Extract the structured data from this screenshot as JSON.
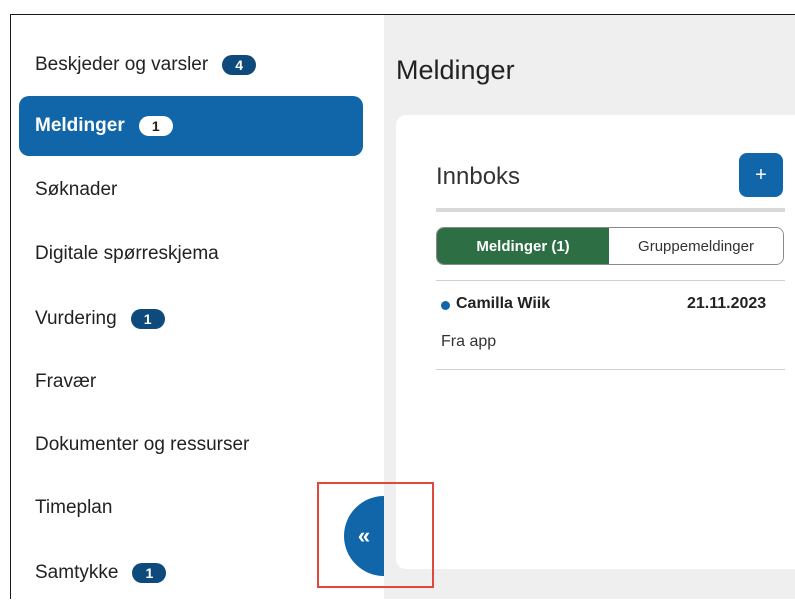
{
  "sidebar": {
    "items": [
      {
        "label": "Beskjeder og varsler",
        "badge": "4"
      },
      {
        "label": "Meldinger",
        "badge": "1"
      },
      {
        "label": "Søknader",
        "badge": ""
      },
      {
        "label": "Digitale spørreskjema",
        "badge": ""
      },
      {
        "label": "Vurdering",
        "badge": "1"
      },
      {
        "label": "Fravær",
        "badge": ""
      },
      {
        "label": "Dokumenter og ressurser",
        "badge": ""
      },
      {
        "label": "Timeplan",
        "badge": ""
      },
      {
        "label": "Samtykke",
        "badge": "1"
      }
    ],
    "collapse_icon": "«"
  },
  "main": {
    "title": "Meldinger",
    "inbox": {
      "title": "Innboks",
      "add_icon": "+",
      "tabs": [
        {
          "label": "Meldinger (1)"
        },
        {
          "label": "Gruppemeldinger"
        }
      ],
      "messages": [
        {
          "sender": "Camilla Wiik",
          "date": "21.11.2023",
          "preview": "Fra app"
        }
      ]
    }
  },
  "colors": {
    "accent": "#1066a8",
    "active_tab": "#2d6e45",
    "highlight": "#e0483d"
  }
}
